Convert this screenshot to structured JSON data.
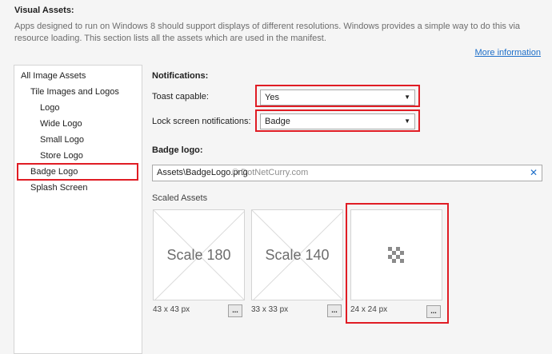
{
  "header": {
    "title": "Visual Assets:",
    "description": "Apps designed to run on Windows 8 should support displays of different resolutions. Windows provides a simple way to do this via resource loading. This section lists all the assets which are used in the manifest.",
    "more_info_label": "More information"
  },
  "sidebar": {
    "items": [
      {
        "label": "All Image Assets"
      },
      {
        "label": "Tile Images and Logos"
      },
      {
        "label": "Logo"
      },
      {
        "label": "Wide Logo"
      },
      {
        "label": "Small Logo"
      },
      {
        "label": "Store Logo"
      },
      {
        "label": "Badge Logo",
        "selected": true
      },
      {
        "label": "Splash Screen"
      }
    ]
  },
  "notifications": {
    "title": "Notifications:",
    "toast_label": "Toast capable:",
    "toast_value": "Yes",
    "lock_label": "Lock screen notifications:",
    "lock_value": "Badge"
  },
  "badge": {
    "title": "Badge logo:",
    "path": "Assets\\BadgeLogo.png",
    "watermark": "© DotNetCurry.com"
  },
  "scaled": {
    "title": "Scaled Assets",
    "tiles": [
      {
        "label": "Scale 180",
        "size": "43 x 43 px"
      },
      {
        "label": "Scale 140",
        "size": "33 x 33 px"
      },
      {
        "label": "",
        "size": "24 x 24 px"
      }
    ],
    "button_label": "..."
  },
  "colors": {
    "highlight": "#e01c24",
    "link": "#1e6fc9",
    "background": "#f5f5f5"
  }
}
